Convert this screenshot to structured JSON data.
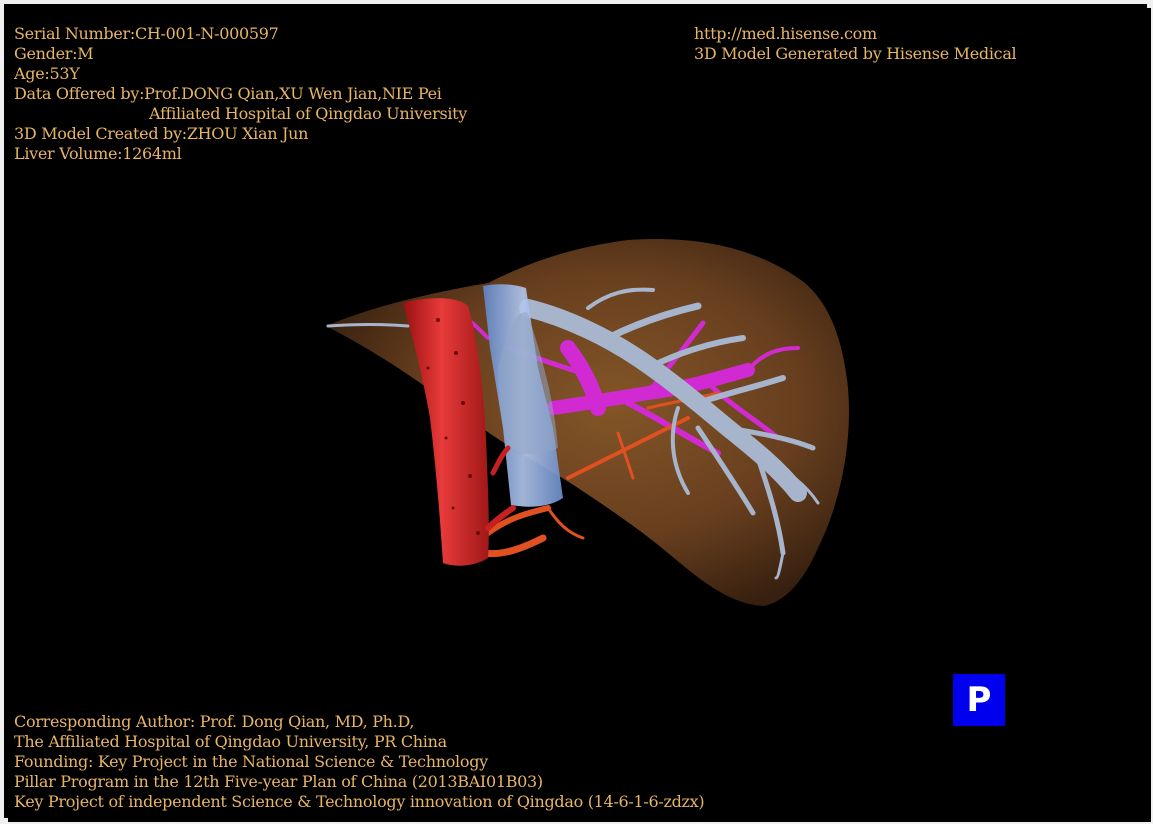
{
  "patient_info": {
    "serial": "Serial Number:CH-001-N-000597",
    "gender": "Gender:M",
    "age": "Age:53Y",
    "data_offered": "Data Offered by:Prof.DONG Qian,XU Wen Jian,NIE Pei",
    "hospital": "Affiliated Hospital of Qingdao University",
    "created_by": "3D Model Created by:ZHOU Xian Jun",
    "liver_volume": "Liver Volume:1264ml"
  },
  "header_right": {
    "url": "http://med.hisense.com",
    "generated_by": "3D Model Generated by Hisense Medical"
  },
  "credits": {
    "line1": "Corresponding Author: Prof. Dong Qian, MD, Ph.D,",
    "line2": "The Affiliated Hospital of Qingdao University, PR China",
    "line3": "Founding: Key Project in the National Science & Technology",
    "line4": "Pillar Program in the 12th Five-year Plan of China (2013BAI01B03)",
    "line5": "Key Project of independent Science & Technology innovation of Qingdao (14-6-1-6-zdzx)"
  },
  "projection_button": {
    "label": "P"
  },
  "colors": {
    "background": "#000000",
    "text": "#e8b565",
    "liver": "#7a4a22",
    "ivc": "#d42a2a",
    "portal_vein": "#a6b4cc",
    "hepatic_vein": "#d22ad2",
    "artery": "#e05020",
    "button": "#0000ee"
  }
}
